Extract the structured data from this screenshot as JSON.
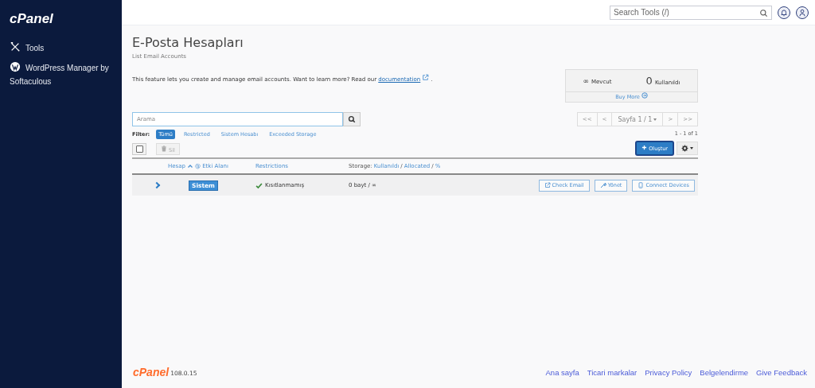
{
  "sidebar": {
    "logo": "cPanel",
    "items": [
      {
        "kind": "tools",
        "label": "Tools"
      },
      {
        "kind": "wordpress",
        "label": "WordPress Manager by Softaculous"
      }
    ]
  },
  "topbar": {
    "search": {
      "placeholder": "Search Tools (/)"
    }
  },
  "page": {
    "title": "E-Posta Hesapları",
    "subtitle": "List Email Accounts",
    "intro_text": "This feature lets you create and manage email accounts. Want to learn more? Read our",
    "intro_link": "documentation",
    "intro_end": "."
  },
  "quota": {
    "available_value": "∞",
    "available_label": "Mevcut",
    "used_value": "0",
    "used_label": "Kullanıldı",
    "buy_more": "Buy More"
  },
  "search": {
    "placeholder": "Arama"
  },
  "filter": {
    "label": "Filter:",
    "options": [
      {
        "label": "Tümü",
        "selected": true
      },
      {
        "label": "Restricted",
        "selected": false
      },
      {
        "label": "Sistem Hesabı",
        "selected": false
      },
      {
        "label": "Exceeded Storage",
        "selected": false
      }
    ]
  },
  "pagination": {
    "buttons": [
      "<<",
      "<"
    ],
    "page": "Sayfa 1 / 1",
    "next_buttons": [
      ">",
      ">>"
    ],
    "range": "1 - 1 of 1"
  },
  "toolbar": {
    "select_all": {
      "checked": false
    },
    "delete": "Sil",
    "create": "Oluştur"
  },
  "table": {
    "columns": {
      "account": "Hesap",
      "domain": "@ Etki Alanı",
      "restrictions": "Restrictions",
      "storage_label": "Storage:",
      "storage_used": "Kullanıldı",
      "separator_1": "/",
      "storage_allocated": "Allocated",
      "separator_2": "/",
      "storage_percent": "%"
    },
    "rows": [
      {
        "expanded": false,
        "badge": "Sistem",
        "restriction": "Kısıtlanmamış",
        "storage": "0 bayt / ∞",
        "actions": [
          {
            "kind": "external",
            "label": "Check Email"
          },
          {
            "kind": "wrench",
            "label": "Yönet"
          },
          {
            "kind": "phone",
            "label": "Connect Devices"
          }
        ]
      }
    ]
  },
  "footer": {
    "logo": "cPanel",
    "version": "108.0.15",
    "links": [
      "Ana sayfa",
      "Ticari markalar",
      "Privacy Policy",
      "Belgelendirme",
      "Give Feedback"
    ]
  }
}
